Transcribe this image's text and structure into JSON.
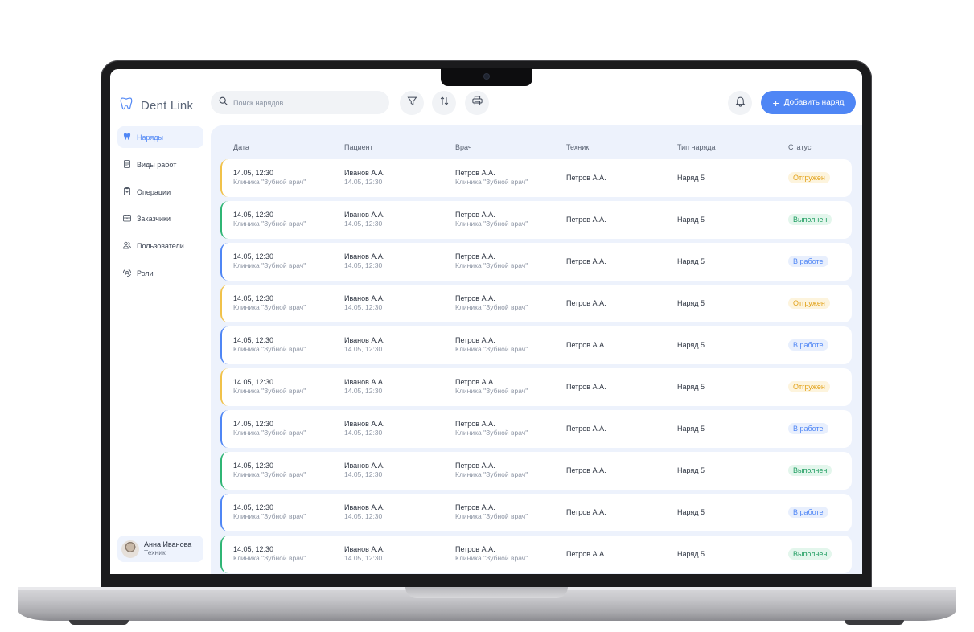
{
  "app": {
    "logo_text": "Dent Link"
  },
  "toolbar": {
    "search_placeholder": "Поиск нарядов",
    "add_button_label": "Добавить наряд",
    "icons": [
      "search-icon",
      "filter-icon",
      "sort-icon",
      "print-icon",
      "bell-icon",
      "plus-icon"
    ]
  },
  "sidebar": {
    "items": [
      {
        "label": "Наряды",
        "icon": "tooth-icon",
        "active": true
      },
      {
        "label": "Виды работ",
        "icon": "document-icon",
        "active": false
      },
      {
        "label": "Операции",
        "icon": "clipboard-plus-icon",
        "active": false
      },
      {
        "label": "Заказчики",
        "icon": "briefcase-icon",
        "active": false
      },
      {
        "label": "Пользователи",
        "icon": "users-icon",
        "active": false
      },
      {
        "label": "Роли",
        "icon": "roles-icon",
        "active": false
      }
    ]
  },
  "user": {
    "name": "Анна Иванова",
    "role": "Техник"
  },
  "table": {
    "columns": [
      "Дата",
      "Пациент",
      "Врач",
      "Техник",
      "Тип наряда",
      "Статус"
    ],
    "status_colors": {
      "Отгружен": {
        "text": "#e2a21a",
        "bg": "#fdf4dd",
        "bar": "#f1c24a"
      },
      "Выполнен": {
        "text": "#1f9d60",
        "bg": "#e3f6ec",
        "bar": "#2fb574"
      },
      "В работе": {
        "text": "#4f86f5",
        "bg": "#e8effd",
        "bar": "#4f86f5"
      }
    },
    "rows": [
      {
        "date": "14.05, 12:30",
        "clinic": "Клиника \"Зубной врач\"",
        "patient": "Иванов А.А.",
        "patient_date": "14.05, 12:30",
        "doctor": "Петров А.А.",
        "doctor_clinic": "Клиника \"Зубной врач\"",
        "technician": "Петров А.А.",
        "type": "Наряд 5",
        "status": "Отгружен"
      },
      {
        "date": "14.05, 12:30",
        "clinic": "Клиника \"Зубной врач\"",
        "patient": "Иванов А.А.",
        "patient_date": "14.05, 12:30",
        "doctor": "Петров А.А.",
        "doctor_clinic": "Клиника \"Зубной врач\"",
        "technician": "Петров А.А.",
        "type": "Наряд 5",
        "status": "Выполнен"
      },
      {
        "date": "14.05, 12:30",
        "clinic": "Клиника \"Зубной врач\"",
        "patient": "Иванов А.А.",
        "patient_date": "14.05, 12:30",
        "doctor": "Петров А.А.",
        "doctor_clinic": "Клиника \"Зубной врач\"",
        "technician": "Петров А.А.",
        "type": "Наряд 5",
        "status": "В работе"
      },
      {
        "date": "14.05, 12:30",
        "clinic": "Клиника \"Зубной врач\"",
        "patient": "Иванов А.А.",
        "patient_date": "14.05, 12:30",
        "doctor": "Петров А.А.",
        "doctor_clinic": "Клиника \"Зубной врач\"",
        "technician": "Петров А.А.",
        "type": "Наряд 5",
        "status": "Отгружен"
      },
      {
        "date": "14.05, 12:30",
        "clinic": "Клиника \"Зубной врач\"",
        "patient": "Иванов А.А.",
        "patient_date": "14.05, 12:30",
        "doctor": "Петров А.А.",
        "doctor_clinic": "Клиника \"Зубной врач\"",
        "technician": "Петров А.А.",
        "type": "Наряд 5",
        "status": "В работе"
      },
      {
        "date": "14.05, 12:30",
        "clinic": "Клиника \"Зубной врач\"",
        "patient": "Иванов А.А.",
        "patient_date": "14.05, 12:30",
        "doctor": "Петров А.А.",
        "doctor_clinic": "Клиника \"Зубной врач\"",
        "technician": "Петров А.А.",
        "type": "Наряд 5",
        "status": "Отгружен"
      },
      {
        "date": "14.05, 12:30",
        "clinic": "Клиника \"Зубной врач\"",
        "patient": "Иванов А.А.",
        "patient_date": "14.05, 12:30",
        "doctor": "Петров А.А.",
        "doctor_clinic": "Клиника \"Зубной врач\"",
        "technician": "Петров А.А.",
        "type": "Наряд 5",
        "status": "В работе"
      },
      {
        "date": "14.05, 12:30",
        "clinic": "Клиника \"Зубной врач\"",
        "patient": "Иванов А.А.",
        "patient_date": "14.05, 12:30",
        "doctor": "Петров А.А.",
        "doctor_clinic": "Клиника \"Зубной врач\"",
        "technician": "Петров А.А.",
        "type": "Наряд 5",
        "status": "Выполнен"
      },
      {
        "date": "14.05, 12:30",
        "clinic": "Клиника \"Зубной врач\"",
        "patient": "Иванов А.А.",
        "patient_date": "14.05, 12:30",
        "doctor": "Петров А.А.",
        "doctor_clinic": "Клиника \"Зубной врач\"",
        "technician": "Петров А.А.",
        "type": "Наряд 5",
        "status": "В работе"
      },
      {
        "date": "14.05, 12:30",
        "clinic": "Клиника \"Зубной врач\"",
        "patient": "Иванов А.А.",
        "patient_date": "14.05, 12:30",
        "doctor": "Петров А.А.",
        "doctor_clinic": "Клиника \"Зубной врач\"",
        "technician": "Петров А.А.",
        "type": "Наряд 5",
        "status": "Выполнен"
      }
    ]
  }
}
